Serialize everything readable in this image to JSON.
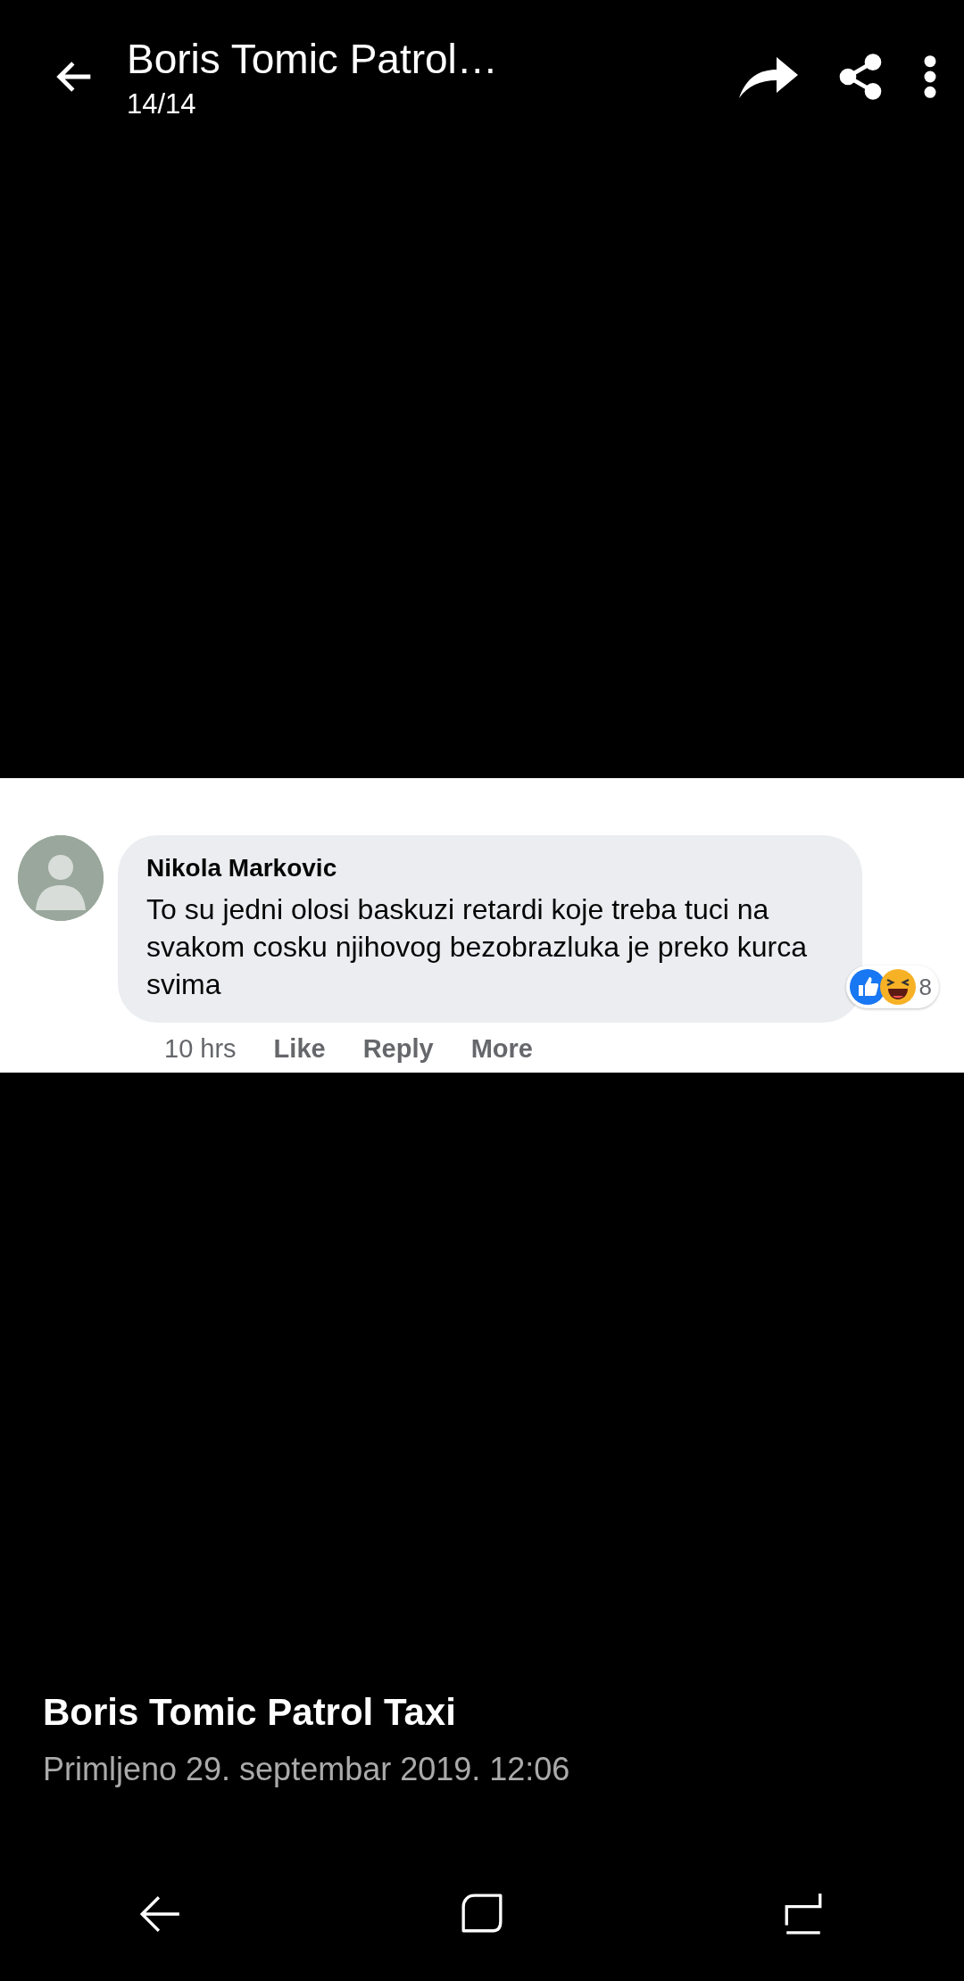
{
  "header": {
    "title": "Boris Tomic Patrol…",
    "counter": "14/14"
  },
  "photo": {
    "comment": {
      "author": "Nikola Markovic",
      "text": "To su jedni olosi baskuzi retardi koje treba tuci na svakom cosku njihovog bezobrazluka je preko kurca svima",
      "reaction_count": "8",
      "time": "10 hrs",
      "actions": [
        "Like",
        "Reply",
        "More"
      ]
    }
  },
  "caption": {
    "title": "Boris Tomic Patrol Taxi",
    "date": "Primljeno 29. septembar 2019. 12:06"
  }
}
